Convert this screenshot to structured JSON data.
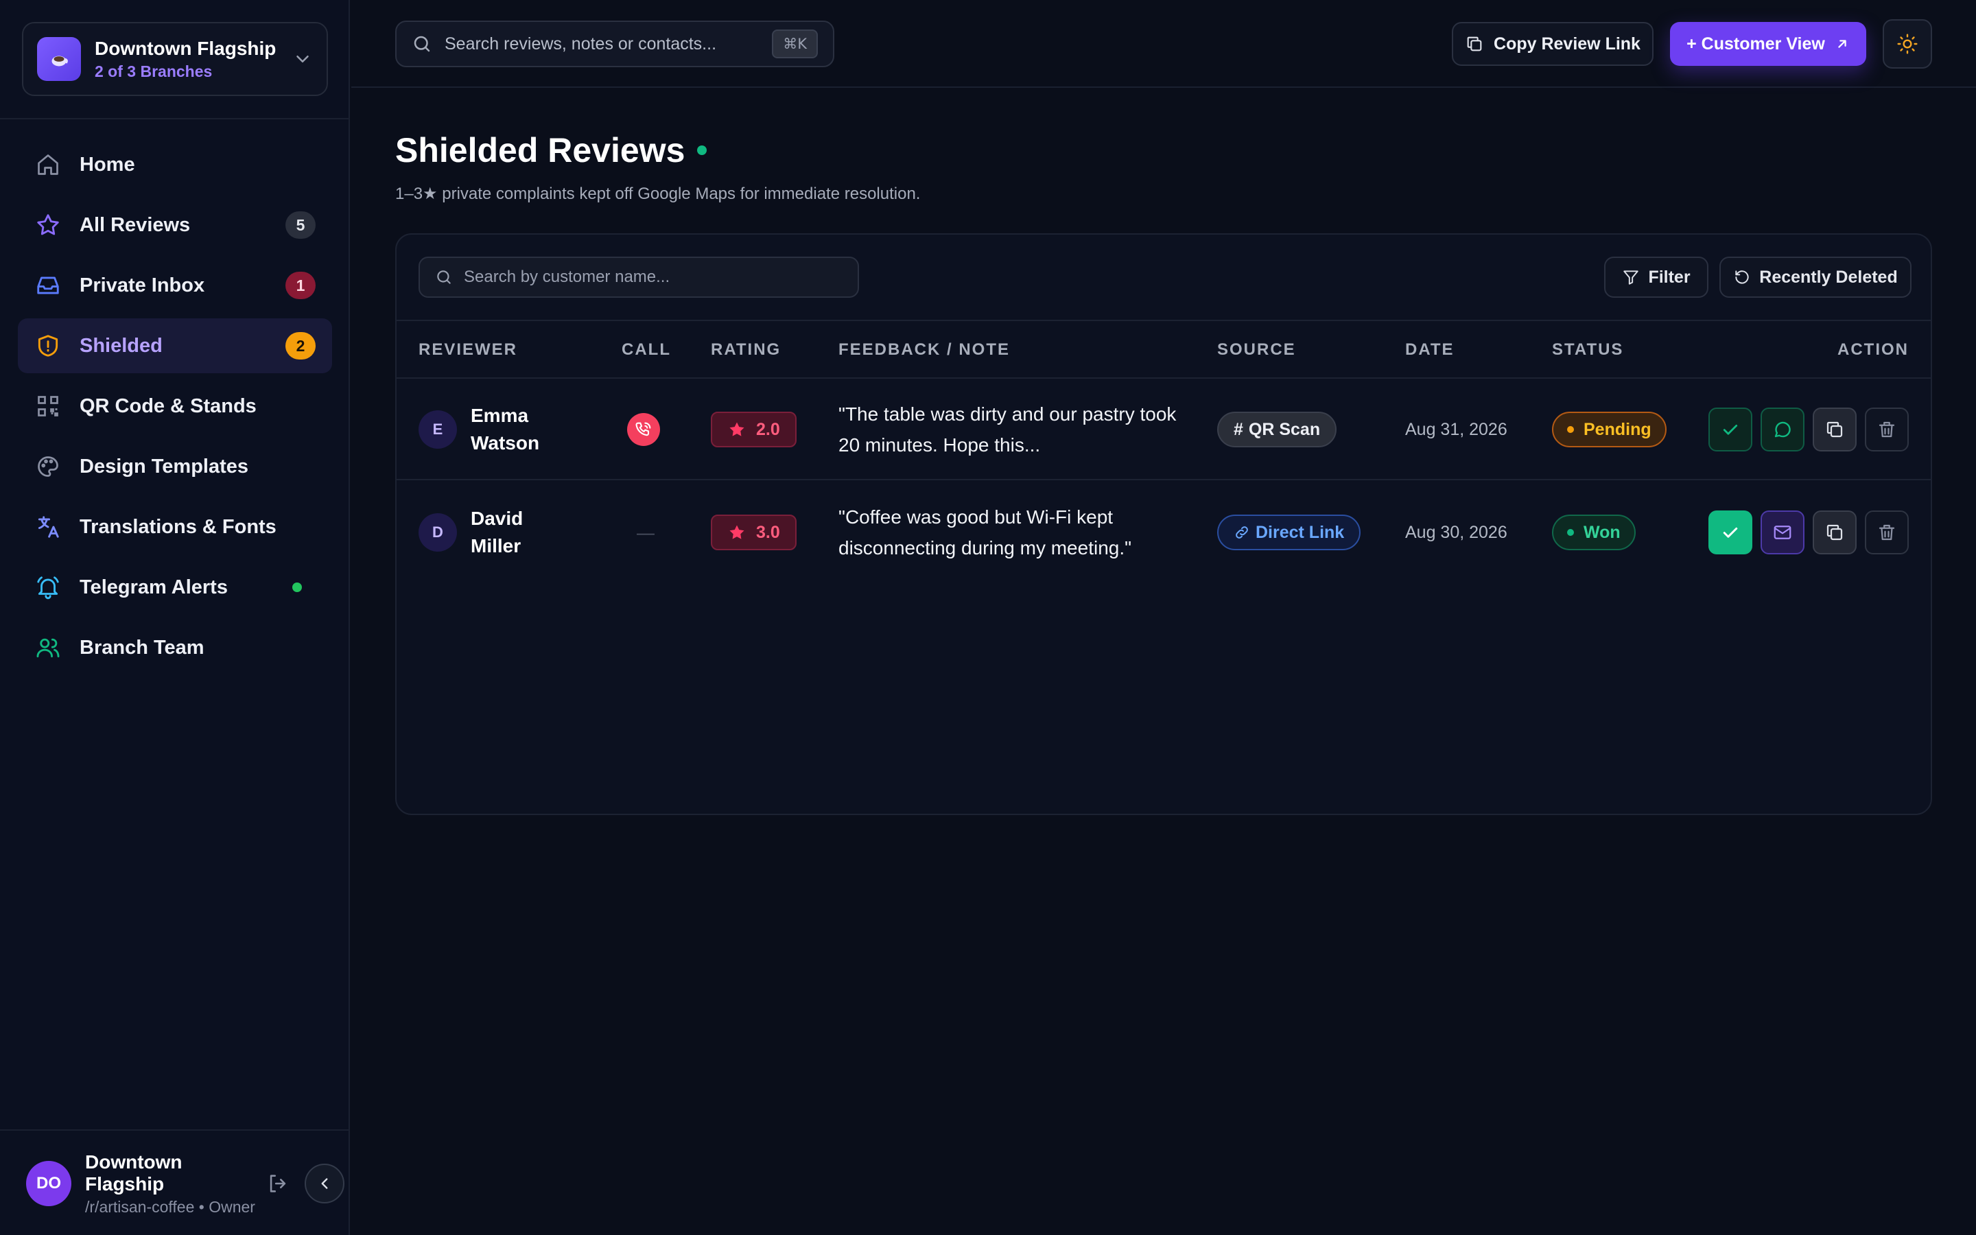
{
  "brand": {
    "name": "Downtown Flagship",
    "sub": "2 of 3 Branches"
  },
  "nav": [
    {
      "label": "Home",
      "icon": "home-icon"
    },
    {
      "label": "All Reviews",
      "icon": "star-icon",
      "badge": "5"
    },
    {
      "label": "Private Inbox",
      "icon": "inbox-icon",
      "badge": "1"
    },
    {
      "label": "Shielded",
      "icon": "shield-alert-icon",
      "badge": "2",
      "active": true
    },
    {
      "label": "QR Code & Stands",
      "icon": "qr-code-icon"
    },
    {
      "label": "Design Templates",
      "icon": "palette-icon"
    },
    {
      "label": "Translations & Fonts",
      "icon": "languages-icon"
    },
    {
      "label": "Telegram Alerts",
      "icon": "bell-ring-icon"
    },
    {
      "label": "Branch Team",
      "icon": "users-icon"
    }
  ],
  "user": {
    "initials": "DO",
    "name": "Downtown Flagship",
    "sub": "/r/artisan-coffee • Owner"
  },
  "topbar": {
    "search_placeholder": "Search reviews, notes or contacts...",
    "shortcut": "⌘K",
    "copy_link": "Copy Review Link",
    "customer_view": "+ Customer View"
  },
  "page": {
    "title": "Shielded Reviews",
    "subtitle": "1–3★ private complaints kept off Google Maps for immediate resolution."
  },
  "panel": {
    "search_placeholder": "Search by customer name...",
    "filter": "Filter",
    "recently_deleted": "Recently Deleted"
  },
  "table": {
    "headers": {
      "reviewer": "REVIEWER",
      "call": "CALL",
      "rating": "RATING",
      "feedback": "FEEDBACK / NOTE",
      "source": "SOURCE",
      "date": "DATE",
      "status": "STATUS",
      "action": "ACTION"
    },
    "rows": [
      {
        "initial": "E",
        "name": "Emma Watson",
        "call": "phone",
        "rating": "2.0",
        "feedback": "\"The table was dirty and our pastry took 20 minutes. Hope this...",
        "source": "QR Scan",
        "date": "Aug 31, 2026",
        "status": "Pending"
      },
      {
        "initial": "D",
        "name": "David Miller",
        "call": "—",
        "rating": "3.0",
        "feedback": "\"Coffee was good but Wi-Fi kept disconnecting during my meeting.\"",
        "source": "Direct Link",
        "date": "Aug 30, 2026",
        "status": "Won"
      }
    ]
  },
  "colors": {
    "accent": "#6d3ff2",
    "pending": "#fbbf24",
    "won": "#34d399",
    "rating": "#ff5d7e",
    "background": "#0a0e1a"
  }
}
